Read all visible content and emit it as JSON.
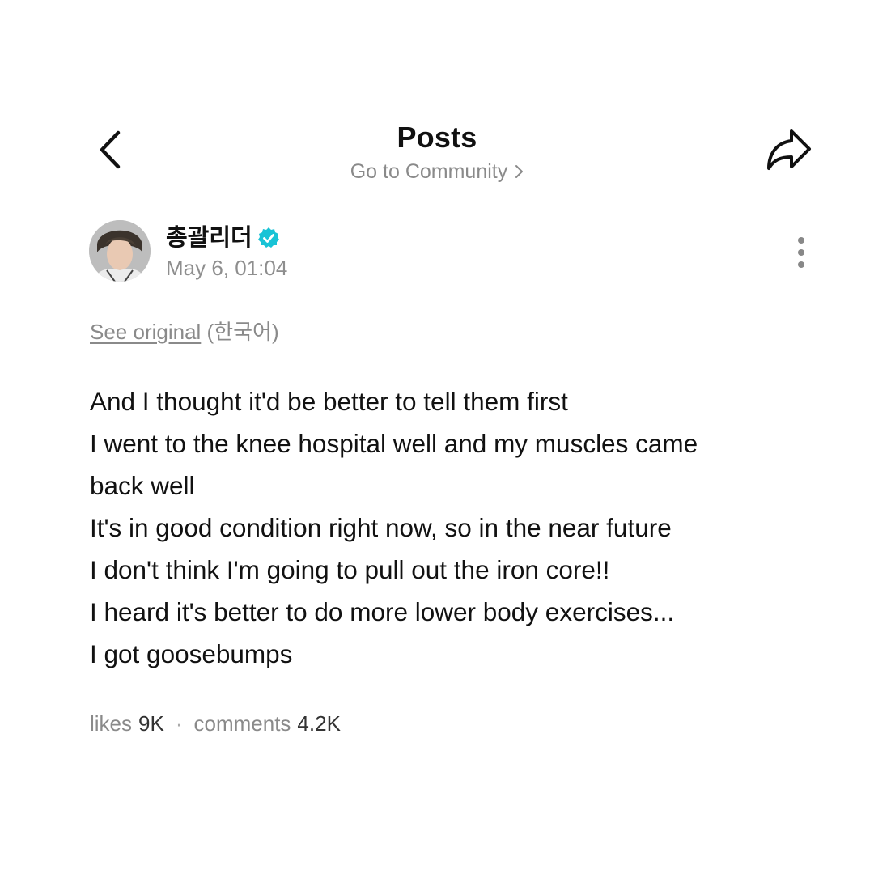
{
  "header": {
    "title": "Posts",
    "community_link": "Go to Community"
  },
  "post": {
    "author": {
      "name": "총괄리더",
      "verified": true,
      "verified_color": "#19c3d6"
    },
    "date": "May 6, 01:04",
    "see_original": {
      "link_text": "See original",
      "language": "(한국어)"
    },
    "body_lines": [
      "And I thought it'd be better to tell them first",
      "I went to the knee hospital well and my muscles came",
      "back well",
      "It's in good condition right now, so in the near future",
      "I don't think I'm going to pull out the iron core!!",
      "I heard it's better to do more lower body exercises...",
      "I got goosebumps"
    ],
    "stats": {
      "likes_label": "likes",
      "likes_count": "9K",
      "separator": "·",
      "comments_label": "comments",
      "comments_count": "4.2K"
    }
  },
  "icons": {
    "back": "chevron-left-icon",
    "share": "share-arrow-icon",
    "more": "more-vertical-icon",
    "verified": "verified-badge-icon",
    "community_chevron": "chevron-right-icon"
  },
  "colors": {
    "background": "#ffffff",
    "text_primary": "#111111",
    "text_secondary": "#8a8a8a"
  }
}
